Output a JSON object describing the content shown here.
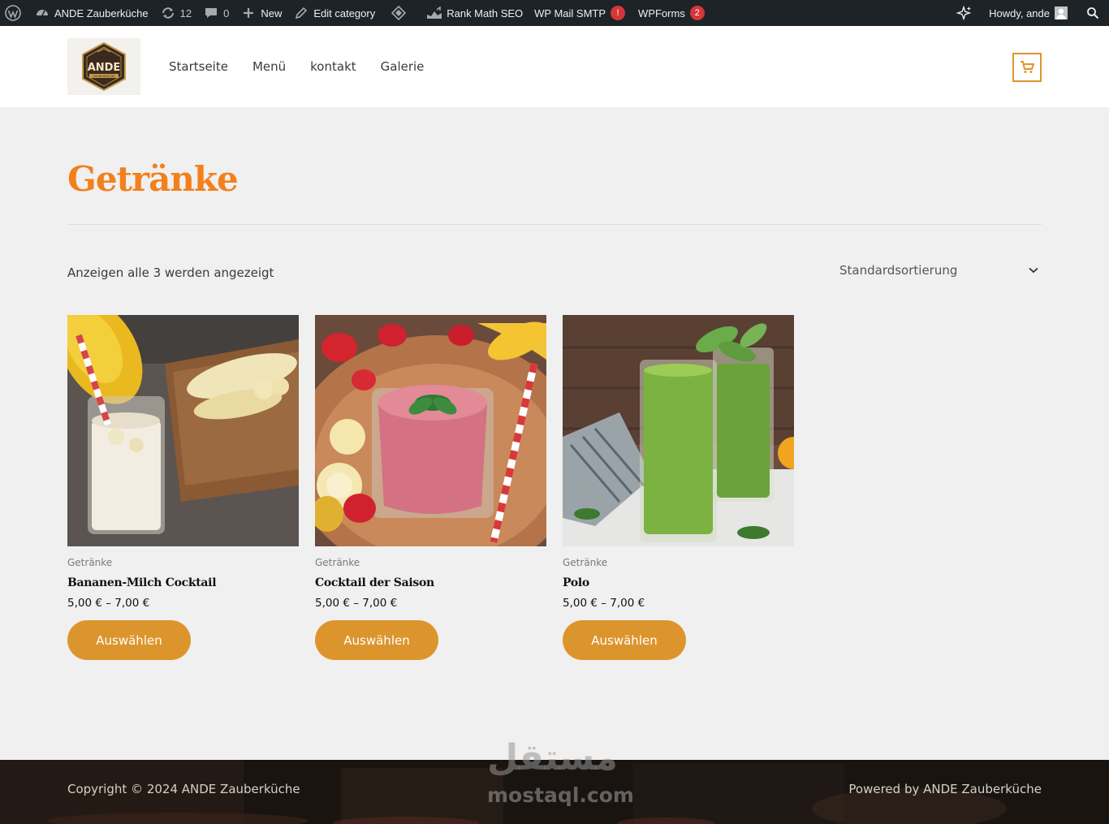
{
  "admin_bar": {
    "site_name": "ANDE Zauberküche",
    "updates_count": "12",
    "comments_count": "0",
    "new_label": "New",
    "edit_label": "Edit category",
    "rank_math_label": "Rank Math SEO",
    "smtp_label": "WP Mail SMTP",
    "smtp_badge": "!",
    "wpforms_label": "WPForms",
    "wpforms_badge": "2",
    "greeting": "Howdy, ande"
  },
  "header": {
    "logo_text": "ANDE",
    "logo_subtext": "ZAUBERKÜCHE",
    "nav": [
      "Startseite",
      "Menü",
      "kontakt",
      "Galerie"
    ]
  },
  "page": {
    "title": "Getränke",
    "result_count": "Anzeigen alle 3 werden angezeigt",
    "ordering": "Standardsortierung"
  },
  "products": [
    {
      "category": "Getränke",
      "name": "Bananen-Milch Cocktail",
      "price": "5,00 € – 7,00 €",
      "button": "Auswählen"
    },
    {
      "category": "Getränke",
      "name": "Cocktail der Saison",
      "price": "5,00 € – 7,00 €",
      "button": "Auswählen"
    },
    {
      "category": "Getränke",
      "name": "Polo",
      "price": "5,00 € – 7,00 €",
      "button": "Auswählen"
    }
  ],
  "footer": {
    "copyright": "Copyright © 2024 ANDE Zauberküche",
    "powered_by": "Powered by ANDE Zauberküche"
  },
  "watermark": {
    "arabic": "مستقل",
    "latin": "mostaql.com"
  },
  "colors": {
    "accent": "#dc952d",
    "title": "#f2801c",
    "admin_bar": "#1d2327"
  }
}
